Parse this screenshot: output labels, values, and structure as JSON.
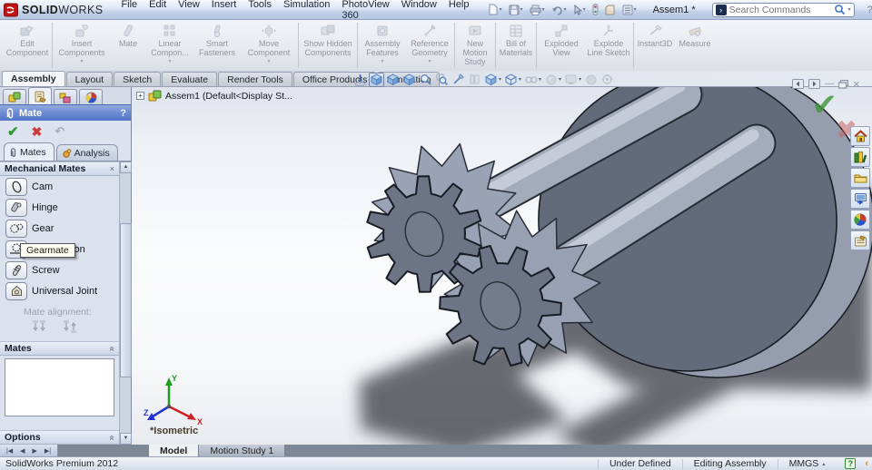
{
  "window": {
    "brand_bold": "SOLID",
    "brand_rest": "WORKS",
    "title": "Assem1 *",
    "search_placeholder": "Search Commands",
    "help_label": "?"
  },
  "menubar": {
    "items": [
      "File",
      "Edit",
      "View",
      "Insert",
      "Tools",
      "Simulation",
      "PhotoView 360",
      "Window",
      "Help"
    ]
  },
  "quickbar": {
    "icons": [
      "new-document",
      "save",
      "print",
      "undo",
      "select",
      "rebuild",
      "file-properties",
      "options"
    ]
  },
  "ribbon": {
    "buttons": [
      {
        "label": "Edit Component",
        "caret": false
      },
      {
        "label": "Insert Components",
        "caret": true
      },
      {
        "label": "Mate",
        "caret": false
      },
      {
        "label": "Linear Compon...",
        "caret": true
      },
      {
        "label": "Smart Fasteners",
        "caret": false
      },
      {
        "label": "Move Component",
        "caret": true
      },
      {
        "label": "Show Hidden Components",
        "caret": false
      },
      {
        "label": "Assembly Features",
        "caret": true
      },
      {
        "label": "Reference Geometry",
        "caret": true
      },
      {
        "label": "New Motion Study",
        "caret": false
      },
      {
        "label": "Bill of Materials",
        "caret": false
      },
      {
        "label": "Exploded View",
        "caret": false
      },
      {
        "label": "Explode Line Sketch",
        "caret": false
      },
      {
        "label": "Instant3D",
        "caret": false
      },
      {
        "label": "Measure",
        "caret": false
      }
    ]
  },
  "tabs": {
    "items": [
      "Assembly",
      "Layout",
      "Sketch",
      "Evaluate",
      "Render Tools",
      "Office Products",
      "Simulation"
    ],
    "active": "Assembly"
  },
  "headsup": {
    "icons": [
      "normal-to",
      "view-orientation",
      "previous-view",
      "3d-views",
      "zoom-to-fit",
      "zoom-to-area",
      "section-view",
      "annotations",
      "display-style",
      "hide-show-items",
      "edit-appearance",
      "apply-scene",
      "view-settings",
      "shadows",
      "camera"
    ]
  },
  "feature_tree": {
    "root": "Assem1  (Default<Display St..."
  },
  "property_manager": {
    "title": "Mate",
    "help": "?",
    "tabs": {
      "mates": "Mates",
      "analysis": "Analysis"
    },
    "mechanical_mates": {
      "title": "Mechanical Mates",
      "items": [
        {
          "label": "Cam",
          "icon": "cam-icon"
        },
        {
          "label": "Hinge",
          "icon": "hinge-icon"
        },
        {
          "label": "Gear",
          "icon": "gear-icon"
        },
        {
          "label": "Rack Pinion",
          "icon": "rack-pinion-icon"
        },
        {
          "label": "Screw",
          "icon": "screw-icon"
        },
        {
          "label": "Universal Joint",
          "icon": "universal-joint-icon"
        }
      ]
    },
    "tooltip": "Gearmate",
    "mate_alignment_label": "Mate alignment:",
    "mates_group_title": "Mates",
    "options_group_title": "Options"
  },
  "viewport": {
    "view_label": "*Isometric",
    "axes": {
      "x": "X",
      "y": "Y",
      "z": "Z"
    }
  },
  "bottom_tabs": {
    "items": [
      "Model",
      "Motion Study 1"
    ],
    "active": "Model"
  },
  "statusbar": {
    "product": "SolidWorks Premium 2012",
    "constraint_state": "Under Defined",
    "mode": "Editing Assembly",
    "units": "MMGS"
  },
  "colors": {
    "pm_header_blue": "#6c8ad2",
    "check_green": "#2f9b2f",
    "cross_red": "#cc3b3b",
    "disc": "#636a79",
    "disc_rim": "#959daf",
    "shaft": "#a4acbb",
    "gear_face": "#6d7485",
    "gear_ring": "#9aa3b5",
    "shadow": "#3f434b"
  }
}
